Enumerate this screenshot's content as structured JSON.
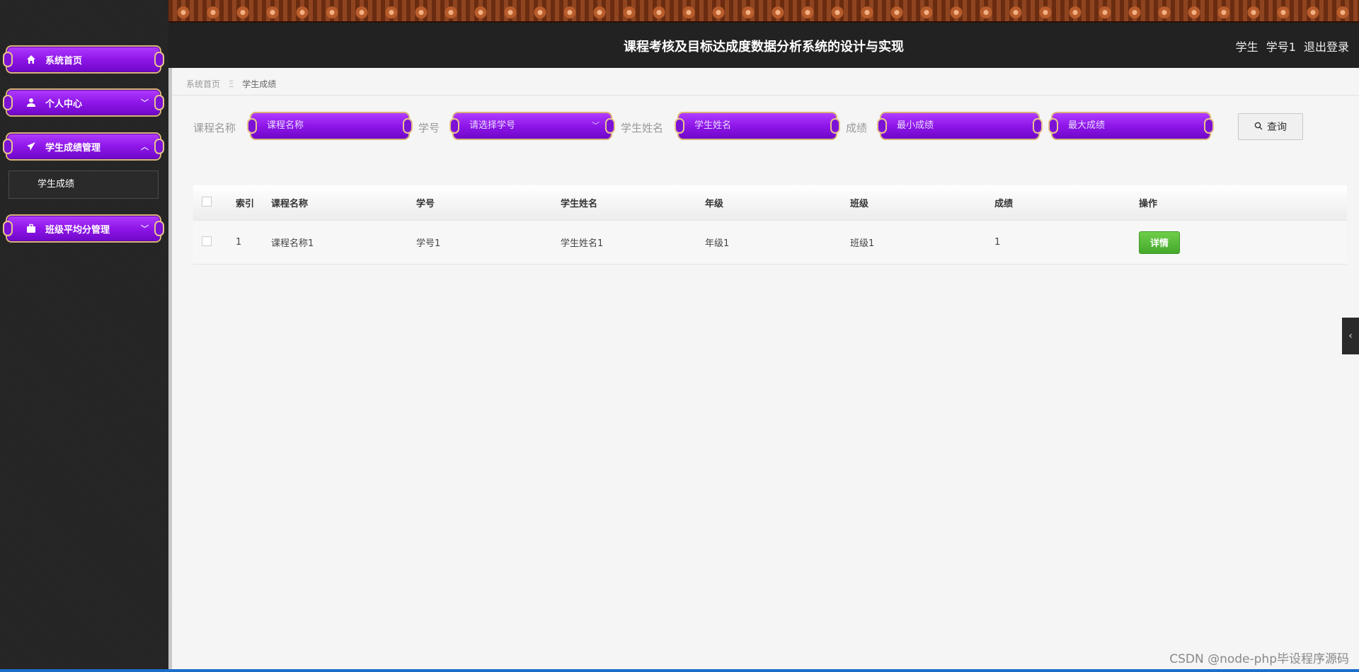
{
  "header": {
    "title": "课程考核及目标达成度数据分析系统的设计与实现",
    "role": "学生",
    "username": "学号1",
    "logout": "退出登录"
  },
  "sidebar": {
    "items": [
      {
        "label": "系统首页",
        "icon": "home-icon"
      },
      {
        "label": "个人中心",
        "icon": "user-icon"
      },
      {
        "label": "学生成绩管理",
        "icon": "paper-plane-icon"
      },
      {
        "label": "班级平均分管理",
        "icon": "briefcase-icon"
      }
    ],
    "submenu": {
      "label": "学生成绩"
    }
  },
  "breadcrumb": {
    "home": "系统首页",
    "separator": "Ξ",
    "current": "学生成绩"
  },
  "search": {
    "course_label": "课程名称",
    "course_placeholder": "课程名称",
    "sno_label": "学号",
    "sno_placeholder": "请选择学号",
    "sname_label": "学生姓名",
    "sname_placeholder": "学生姓名",
    "score_label": "成绩",
    "min_placeholder": "最小成绩",
    "max_placeholder": "最大成绩",
    "query_label": "查询"
  },
  "table": {
    "headers": [
      "索引",
      "课程名称",
      "学号",
      "学生姓名",
      "年级",
      "班级",
      "成绩",
      "操作"
    ],
    "rows": [
      {
        "index": "1",
        "course": "课程名称1",
        "sno": "学号1",
        "sname": "学生姓名1",
        "grade": "年级1",
        "class": "班级1",
        "score": "1",
        "action": "详情"
      }
    ]
  },
  "watermark": "CSDN @node-php毕设程序源码"
}
